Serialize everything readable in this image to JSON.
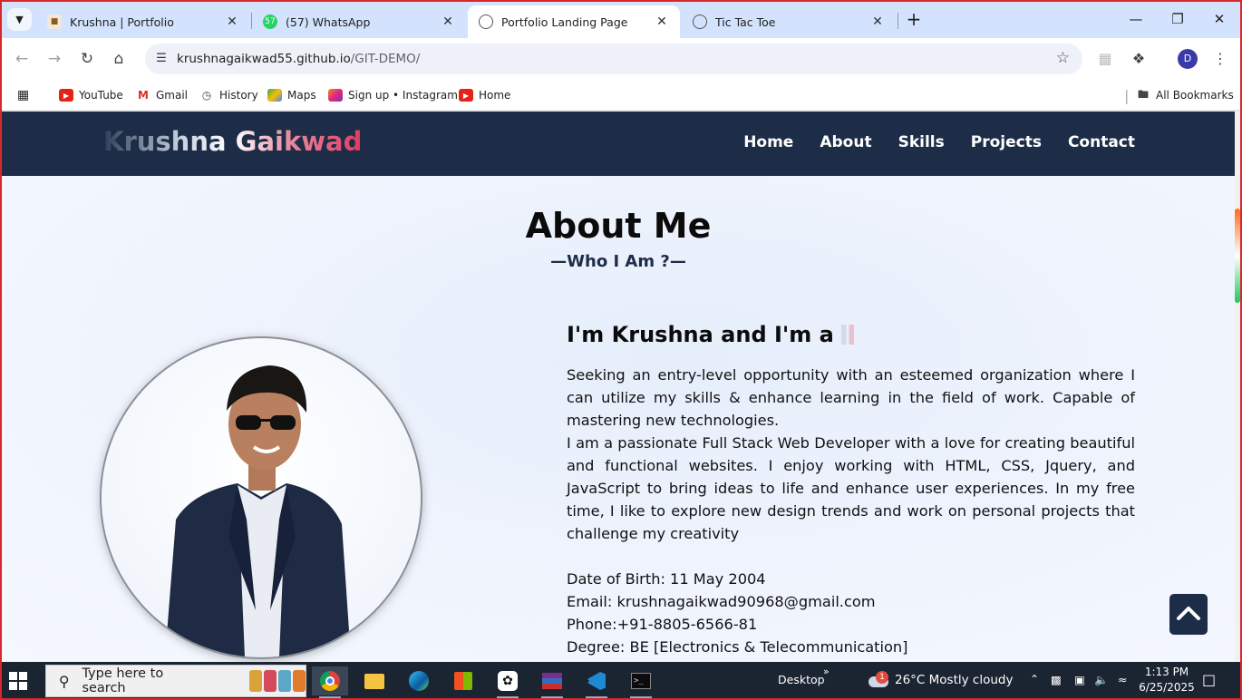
{
  "browser": {
    "tabs": [
      {
        "label": "Krushna | Portfolio",
        "active": false
      },
      {
        "label": "(57) WhatsApp",
        "active": false,
        "badge": "57"
      },
      {
        "label": "Portfolio Landing Page",
        "active": true
      },
      {
        "label": "Tic Tac Toe",
        "active": false
      }
    ],
    "url_host": "krushnagaikwad55.github.io",
    "url_path": "/GIT-DEMO/",
    "profile_initial": "D",
    "bookmarks": [
      "YouTube",
      "Gmail",
      "History",
      "Maps",
      "Sign up • Instagram",
      "Home"
    ],
    "all_bookmarks": "All Bookmarks"
  },
  "site": {
    "brand": "Krushna Gaikwad",
    "nav": [
      "Home",
      "About",
      "Skills",
      "Projects",
      "Contact"
    ],
    "about_title": "About Me",
    "about_subtitle": "—Who I Am ?—",
    "intro": "I'm Krushna and I'm a",
    "para1": "Seeking an entry-level opportunity with an esteemed organization where I can utilize my skills & enhance learning in the field of work. Capable of mastering new technologies.",
    "para2": "I am a passionate Full Stack Web Developer with a love for creating beautiful and functional websites. I enjoy working with HTML, CSS, Jquery, and JavaScript to bring ideas to life and enhance user experiences. In my free time, I like to explore new design trends and work on personal projects that challenge my creativity",
    "details": [
      "Date of Birth: 11 May 2004",
      "Email: krushnagaikwad90968@gmail.com",
      "Phone:+91-8805-6566-81",
      "Degree: BE [Electronics & Telecommunication]"
    ]
  },
  "taskbar": {
    "search_placeholder": "Type here to search",
    "desktop_label": "Desktop",
    "weather": "26°C  Mostly cloudy",
    "weather_badge": "1",
    "time": "1:13 PM",
    "date": "6/25/2025"
  },
  "colors": {
    "nav_bg": "#1d2d47",
    "tabstrip_bg": "#d3e3fd",
    "taskbar_bg": "#1b2431",
    "brand_accent": "#e23a5e"
  }
}
